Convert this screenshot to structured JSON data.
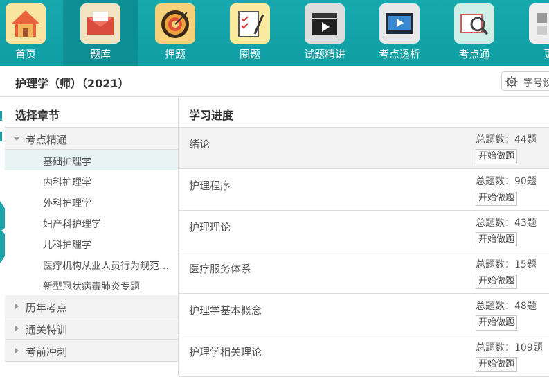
{
  "toolbar": {
    "items": [
      {
        "label": "首页",
        "icon": "home-icon",
        "color": "#f6c85f"
      },
      {
        "label": "题库",
        "icon": "envelope-icon",
        "color": "#f2e3c2"
      },
      {
        "label": "押题",
        "icon": "target-icon",
        "color": "#f6d17a"
      },
      {
        "label": "圈题",
        "icon": "clipboard-pen-icon",
        "color": "#fbeaa0"
      },
      {
        "label": "试题精讲",
        "icon": "clapperboard-icon",
        "color": "#dcdcdc"
      },
      {
        "label": "考点透析",
        "icon": "video-player-icon",
        "color": "#e8e8e8"
      },
      {
        "label": "考点通",
        "icon": "book-magnifier-icon",
        "color": "#cfeee6"
      },
      {
        "label": "更",
        "icon": "more-icon",
        "color": "#eeeeee"
      }
    ]
  },
  "header": {
    "title": "护理学（师）（2021）",
    "font_button": "字号设"
  },
  "left": {
    "heading": "选择章节",
    "groups": [
      {
        "label": "考点精通",
        "expanded": true,
        "children": [
          "基础护理学",
          "内科护理学",
          "外科护理学",
          "妇产科护理学",
          "儿科护理学",
          "医疗机构从业人员行为规范与医学伦理学",
          "新型冠状病毒肺炎专题"
        ]
      },
      {
        "label": "历年考点",
        "expanded": false
      },
      {
        "label": "通关特训",
        "expanded": false
      },
      {
        "label": "考前冲刺",
        "expanded": false
      }
    ]
  },
  "right": {
    "heading": "学习进度",
    "count_prefix": "总题数：",
    "rows": [
      {
        "name": "绪论",
        "count": "总题数：44题",
        "button": "开始做题"
      },
      {
        "name": "护理程序",
        "count": "总题数：90题",
        "button": "开始做题"
      },
      {
        "name": "护理理论",
        "count": "总题数：43题",
        "button": "开始做题"
      },
      {
        "name": "医疗服务体系",
        "count": "总题数：15题",
        "button": "开始做题"
      },
      {
        "name": "护理学基本概念",
        "count": "总题数：48题",
        "button": "开始做题"
      },
      {
        "name": "护理学相关理论",
        "count": "总题数：109题",
        "button": "开始做题"
      }
    ]
  },
  "colors": {
    "toolbar_bg": "#17a9ae",
    "accent": "#1aa3a8",
    "selected_row": "#e8f3f4"
  }
}
